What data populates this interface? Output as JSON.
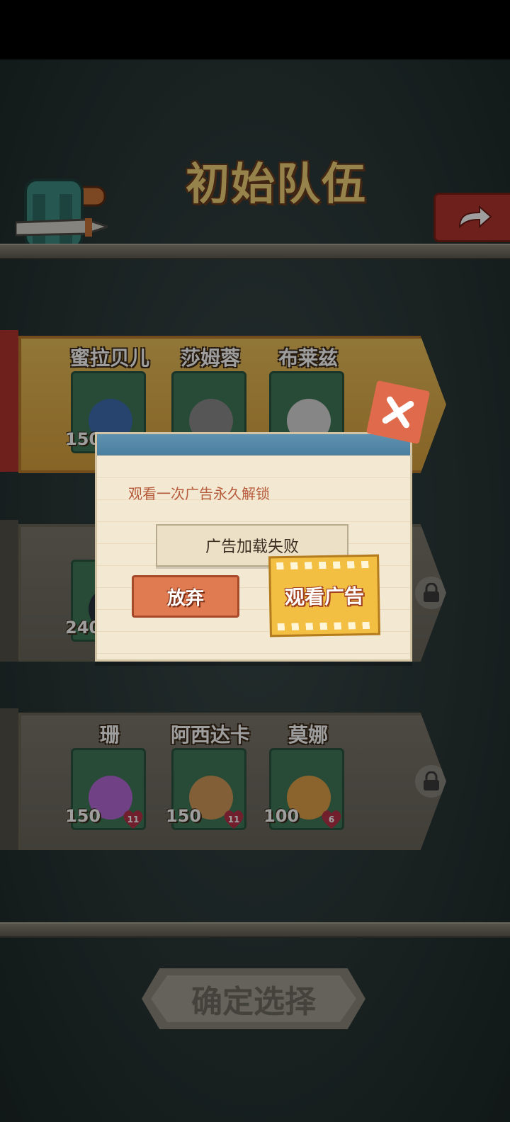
{
  "header": {
    "title": "初始队伍"
  },
  "teams": [
    {
      "style": "gold",
      "members": [
        {
          "name": "蜜拉贝儿",
          "hp": "150",
          "hearts": "",
          "color": "#3e6fb0"
        },
        {
          "name": "莎姆蓉",
          "hp": "",
          "hearts": "",
          "color": "#8c8c8c"
        },
        {
          "name": "布莱兹",
          "hp": "",
          "hearts": "",
          "color": "#d9d9d9"
        }
      ]
    },
    {
      "style": "grey",
      "members": [
        {
          "name": "",
          "hp": "240",
          "hearts": "",
          "color": "#2b3140"
        }
      ],
      "locked": true
    },
    {
      "style": "grey",
      "members": [
        {
          "name": "珊",
          "hp": "150",
          "hearts": "11",
          "color": "#b56ad6"
        },
        {
          "name": "阿西达卡",
          "hp": "150",
          "hearts": "11",
          "color": "#d49a5b"
        },
        {
          "name": "莫娜",
          "hp": "100",
          "hearts": "6",
          "color": "#e0a04a"
        }
      ],
      "locked": true
    }
  ],
  "dialog": {
    "message": "观看一次广告永久解锁",
    "status": "广告加载失败",
    "giveup_label": "放弃",
    "watch_label": "观看广告"
  },
  "confirm_label": "确定选择",
  "colors": {
    "accent": "#b2362e",
    "gold": "#f2bf42",
    "dialog_header": "#4a7f9f"
  }
}
